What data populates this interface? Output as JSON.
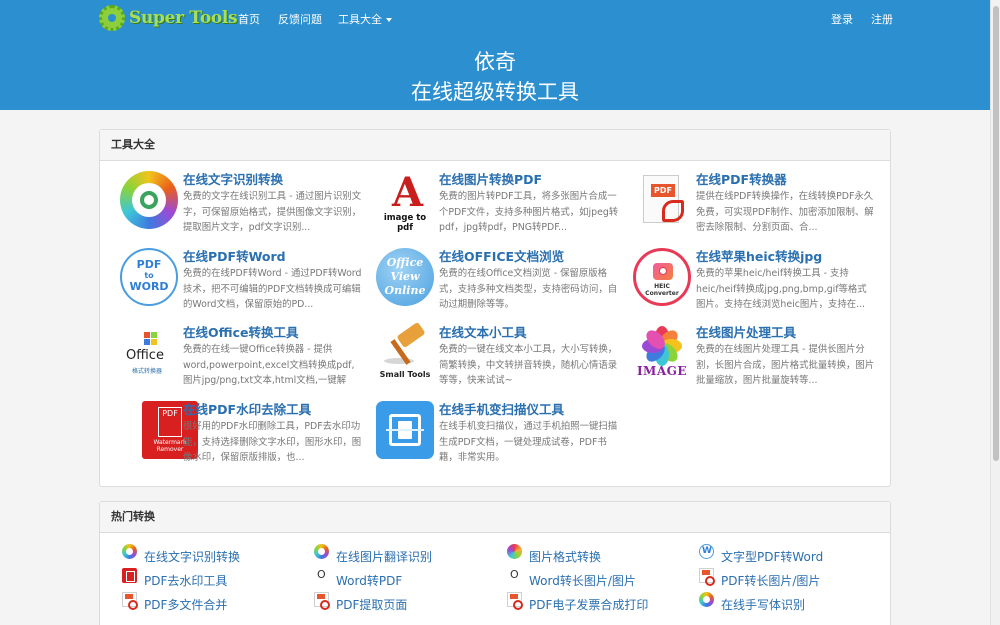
{
  "nav": {
    "logo_text": "Super Tools",
    "home": "首页",
    "feedback": "反馈问题",
    "tools_menu": "工具大全",
    "login": "登录",
    "register": "注册"
  },
  "hero": {
    "line1": "依奇",
    "line2": "在线超级转换工具"
  },
  "tools_panel": {
    "title": "工具大全",
    "items": [
      {
        "title": "在线文字识别转换",
        "desc": "免费的文字在线识别工具 - 通过图片识别文字，可保留原始格式，提供图像文字识别，提取图片文字，pdf文字识别..."
      },
      {
        "title": "在线图片转换PDF",
        "desc": "免费的图片转PDF工具，将多张图片合成一个PDF文件，支持多种图片格式，如jpeg转pdf，jpg转pdf，PNG转PDF..."
      },
      {
        "title": "在线PDF转换器",
        "desc": "提供在线PDF转换操作，在线转换PDF永久免费，可实现PDF制作、加密添加限制、解密去除限制、分割页面、合..."
      },
      {
        "title": "在线PDF转Word",
        "desc": "免费的在线PDF转Word - 通过PDF转Word技术，把不可编辑的PDF文档转换成可编辑的Word文档，保留原始的PD..."
      },
      {
        "title": "在线OFFICE文档浏览",
        "desc": "免费的在线Office文档浏览 - 保留原版格式，支持多种文档类型，支持密码访问，自动过期删除等等。"
      },
      {
        "title": "在线苹果heic转换jpg",
        "desc": "免费的苹果heic/heif转换工具 - 支持heic/heif转换成jpg,png,bmp,gif等格式图片。支持在线浏览heic图片，支持在..."
      },
      {
        "title": "在线Office转换工具",
        "desc": "免费的在线一键Office转换器 - 提供word,powerpoint,excel文档转换成pdf,图片jpg/png,txt文本,html文档,一键解除..."
      },
      {
        "title": "在线文本小工具",
        "desc": "免费的一键在线文本小工具，大小写转换，简繁转换，中文转拼音转换，随机心情语录等等，快来试试~"
      },
      {
        "title": "在线图片处理工具",
        "desc": "免费的在线图片处理工具 - 提供长图片分割，长图片合成，图片格式批量转换，图片批量缩放，图片批量旋转等..."
      },
      {
        "title": "在线PDF水印去除工具",
        "desc": "很好用的PDF水印删除工具，PDF去水印功能，支持选择删除文字水印，图形水印，图像水印，保留原版排版，也..."
      },
      {
        "title": "在线手机变扫描仪工具",
        "desc": "在线手机变扫描仪，通过手机拍照一键扫描生成PDF文档，一键处理成试卷，PDF书籍，非常实用。"
      }
    ],
    "icon_labels": {
      "topdf": "image to pdf",
      "pdfconv_tag": "PDF",
      "pdfword_top": "PDF",
      "pdfword_mid": "to",
      "pdfword_bottom": "WORD",
      "office_view_1": "Office",
      "office_view_2": "View",
      "office_view_3": "Online",
      "heic_1": "HEIC",
      "heic_2": "Converter",
      "office_word": "Office",
      "office_sub": "格式转换器",
      "small_tools": "Small Tools",
      "image_word": "IMAGE",
      "wm_pdf": "PDF",
      "wm_1": "Watermark",
      "wm_2": "Remover"
    }
  },
  "hot_panel": {
    "title": "热门转换",
    "items": [
      "在线文字识别转换",
      "在线图片翻译识别",
      "图片格式转换",
      "文字型PDF转Word",
      "PDF去水印工具",
      "Word转PDF",
      "Word转长图片/图片",
      "PDF转长图片/图片",
      "PDF多文件合并",
      "PDF提取页面",
      "PDF电子发票合成打印",
      "在线手写体识别"
    ]
  }
}
